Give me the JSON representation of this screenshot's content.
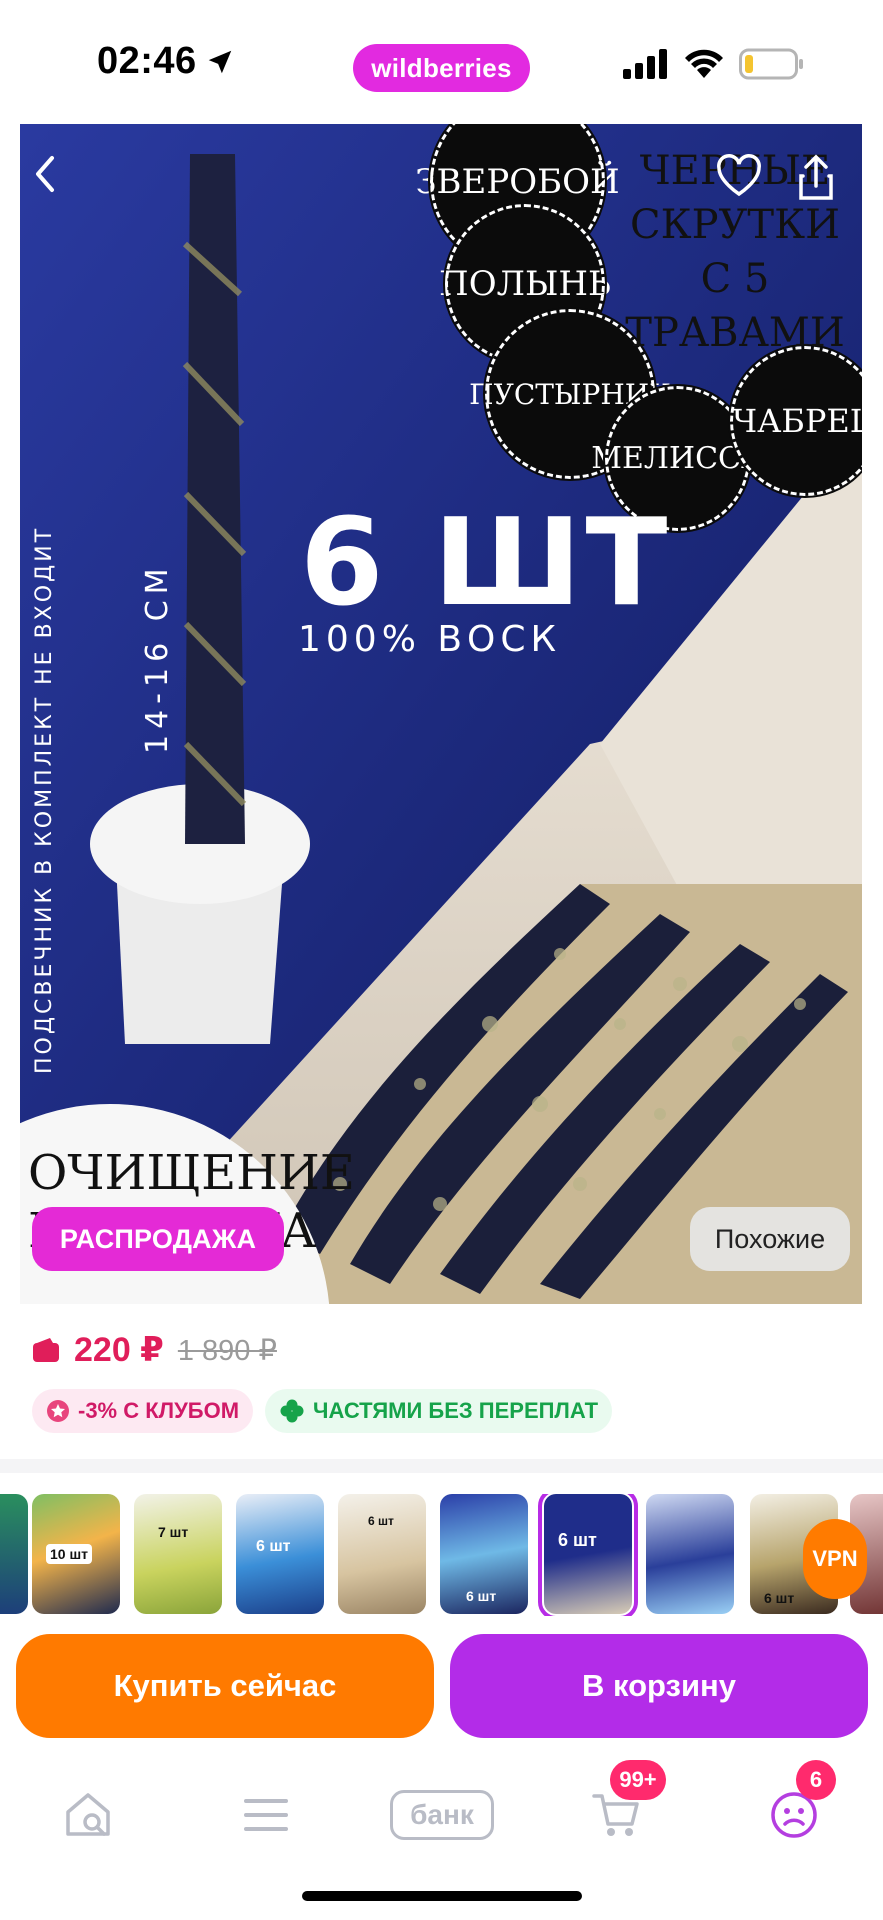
{
  "status_bar": {
    "time": "02:46",
    "brand": "wildberries",
    "icons": [
      "location-arrow-icon",
      "signal-icon",
      "wifi-icon",
      "battery-icon"
    ]
  },
  "hero": {
    "headline_count": "6 ШТ",
    "headline_sub": "100% ВОСК",
    "title_lines": [
      "ЧЕРНЫЕ",
      "СКРУТКИ С 5",
      "ТРАВАМИ"
    ],
    "herbs": [
      "ЗВЕРОБОЙ",
      "ПОЛЫНЬ",
      "ПУСТЫРНИК",
      "МЕЛИССА",
      "ЧАБРЕЦ"
    ],
    "size_label": "14-16 СМ",
    "side_note": "ПОДСВЕЧНИК В КОМПЛЕКТ НЕ ВХОДИТ",
    "corner_text_line1": "ОЧИЩЕНИЕ",
    "corner_text_line2": "И ЗАЩИТА",
    "sale_badge": "РАСПРОДАЖА",
    "similar_button": "Похожие"
  },
  "price": {
    "current": "220 ₽",
    "old": "1 890 ₽"
  },
  "tags": {
    "club": "-3% С КЛУБОМ",
    "installments": "ЧАСТЯМИ БЕЗ ПЕРЕПЛАТ"
  },
  "thumbnails": {
    "labels": [
      "10 шт",
      "7 шт",
      "6 шт",
      "6 шт",
      "6 шт",
      "6 шт",
      "6 шт"
    ],
    "selected_index": 5
  },
  "vpn_label": "VPN",
  "actions": {
    "buy_now": "Купить сейчас",
    "add_to_cart": "В корзину"
  },
  "tabbar": {
    "bank_label": "банк",
    "cart_badge": "99+",
    "profile_badge": "6"
  },
  "colors": {
    "brand": "#e22ae0",
    "price": "#e01e5a",
    "buy": "#ff7a00",
    "cart": "#b32ce8"
  }
}
